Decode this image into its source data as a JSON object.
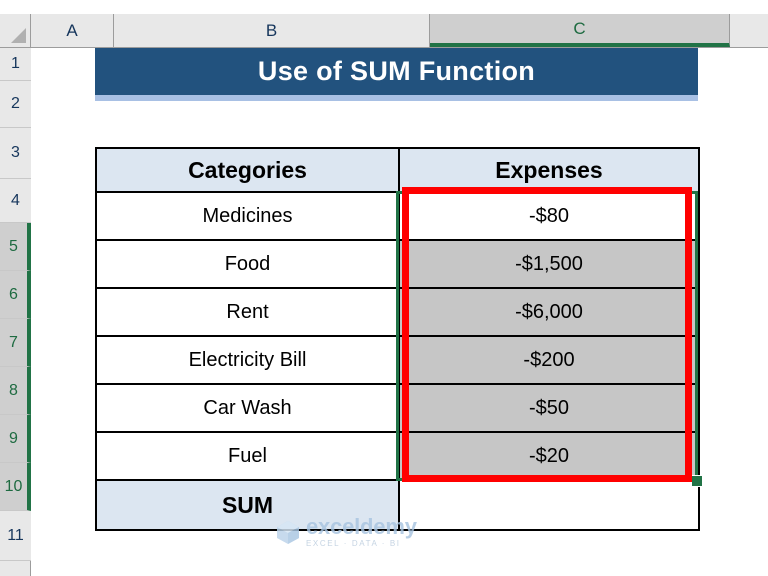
{
  "app": {
    "type": "spreadsheet",
    "corner_icon": "select-all-triangle-icon"
  },
  "grid": {
    "columns": [
      {
        "label": "A",
        "selected": false
      },
      {
        "label": "B",
        "selected": false
      },
      {
        "label": "C",
        "selected": true
      }
    ],
    "rows": [
      {
        "label": "1",
        "selected": false
      },
      {
        "label": "2",
        "selected": false
      },
      {
        "label": "3",
        "selected": false
      },
      {
        "label": "4",
        "selected": false
      },
      {
        "label": "5",
        "selected": true
      },
      {
        "label": "6",
        "selected": true
      },
      {
        "label": "7",
        "selected": true
      },
      {
        "label": "8",
        "selected": true
      },
      {
        "label": "9",
        "selected": true
      },
      {
        "label": "10",
        "selected": true
      },
      {
        "label": "11",
        "selected": false
      }
    ]
  },
  "title": {
    "text": "Use of SUM Function",
    "background_color": "#22527E",
    "text_color": "#FFFFFF",
    "underline_color": "#A8C0E4"
  },
  "table": {
    "headers": {
      "categories": "Categories",
      "expenses": "Expenses"
    },
    "header_background": "#DCE6F1",
    "rows": [
      {
        "category": "Medicines",
        "expense": "-$80",
        "expense_state": "active"
      },
      {
        "category": "Food",
        "expense": "-$1,500",
        "expense_state": "selected"
      },
      {
        "category": "Rent",
        "expense": "-$6,000",
        "expense_state": "selected"
      },
      {
        "category": "Electricity Bill",
        "expense": "-$200",
        "expense_state": "selected"
      },
      {
        "category": "Car Wash",
        "expense": "-$50",
        "expense_state": "selected"
      },
      {
        "category": "Fuel",
        "expense": "-$20",
        "expense_state": "selected"
      }
    ],
    "total_row": {
      "label": "SUM",
      "value": ""
    }
  },
  "selection": {
    "range": "C5:C10",
    "border_color": "#217346",
    "fill_color": "#C6C6C6",
    "fill_handle": "fill-handle"
  },
  "annotation": {
    "shape": "rectangle",
    "color": "#FF0000",
    "targets": "C5:C10"
  },
  "watermark": {
    "name": "exceldemy",
    "tagline": "EXCEL · DATA · BI",
    "color": "#A8C4E0"
  }
}
